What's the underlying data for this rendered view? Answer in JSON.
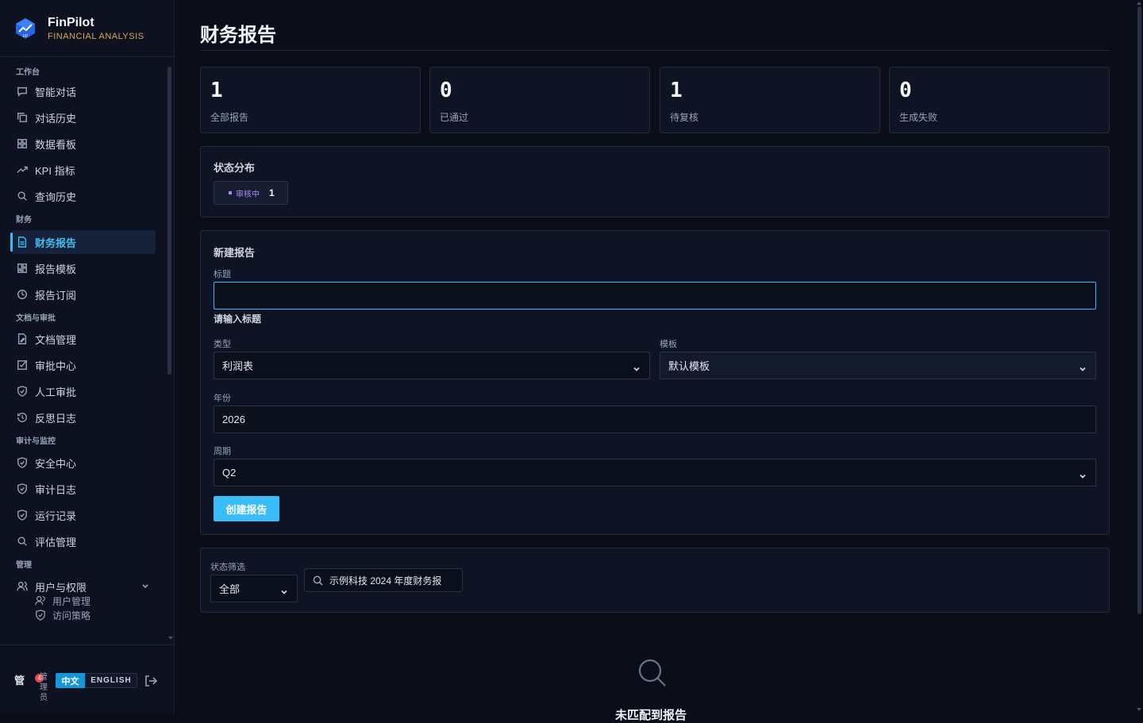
{
  "brand": {
    "name": "FinPilot",
    "subtitle": "FINANCIAL ANALYSIS"
  },
  "sidebar": {
    "sections": [
      {
        "title": "工作台",
        "items": [
          {
            "label": "智能对话",
            "icon": "chat-icon"
          },
          {
            "label": "对话历史",
            "icon": "copy-icon"
          },
          {
            "label": "数据看板",
            "icon": "dashboard-icon"
          },
          {
            "label": "KPI 指标",
            "icon": "trend-icon"
          },
          {
            "label": "查询历史",
            "icon": "search-icon"
          }
        ]
      },
      {
        "title": "财务",
        "items": [
          {
            "label": "财务报告",
            "icon": "document-icon",
            "active": true
          },
          {
            "label": "报告模板",
            "icon": "template-icon"
          },
          {
            "label": "报告订阅",
            "icon": "clock-icon"
          }
        ]
      },
      {
        "title": "文档与审批",
        "items": [
          {
            "label": "文档管理",
            "icon": "file-edit-icon"
          },
          {
            "label": "审批中心",
            "icon": "check-square-icon"
          },
          {
            "label": "人工审批",
            "icon": "shield-icon"
          },
          {
            "label": "反思日志",
            "icon": "history-icon"
          }
        ]
      },
      {
        "title": "审计与监控",
        "items": [
          {
            "label": "安全中心",
            "icon": "shield-icon"
          },
          {
            "label": "审计日志",
            "icon": "shield-icon"
          },
          {
            "label": "运行记录",
            "icon": "shield-icon"
          },
          {
            "label": "评估管理",
            "icon": "search-icon"
          }
        ]
      },
      {
        "title": "管理",
        "items": [
          {
            "label": "用户与权限",
            "icon": "users-icon"
          }
        ]
      }
    ],
    "sub_items": [
      {
        "label": "用户管理",
        "icon": "users-icon"
      },
      {
        "label": "访问策略",
        "icon": "shield-icon"
      }
    ],
    "footer": {
      "avatar": "管",
      "badge": "4",
      "user_name": "管理员",
      "lang_zh": "中文",
      "lang_en": "ENGLISH"
    }
  },
  "page": {
    "title": "财务报告"
  },
  "stats": [
    {
      "value": "1",
      "label": "全部报告"
    },
    {
      "value": "0",
      "label": "已通过"
    },
    {
      "value": "1",
      "label": "待复核"
    },
    {
      "value": "0",
      "label": "生成失败"
    }
  ],
  "status_distribution": {
    "title": "状态分布",
    "chip_label": "审核中",
    "chip_count": "1",
    "chip_color": "#a78bfa"
  },
  "form": {
    "title": "新建报告",
    "title_label": "标题",
    "title_value": "",
    "title_error": "请输入标题",
    "type_label": "类型",
    "type_value": "利润表",
    "template_label": "模板",
    "template_value": "默认模板",
    "year_label": "年份",
    "year_value": "2026",
    "period_label": "周期",
    "period_value": "Q2",
    "submit_label": "创建报告"
  },
  "filter": {
    "status_label": "状态筛选",
    "status_value": "全部",
    "search_value": "示例科技 2024 年度财务报"
  },
  "empty": {
    "text": "未匹配到报告"
  },
  "colors": {
    "accent": "#38bdf8",
    "background": "#0b0e19",
    "panel": "#0f1425",
    "brand_sub": "#d8a84a"
  }
}
